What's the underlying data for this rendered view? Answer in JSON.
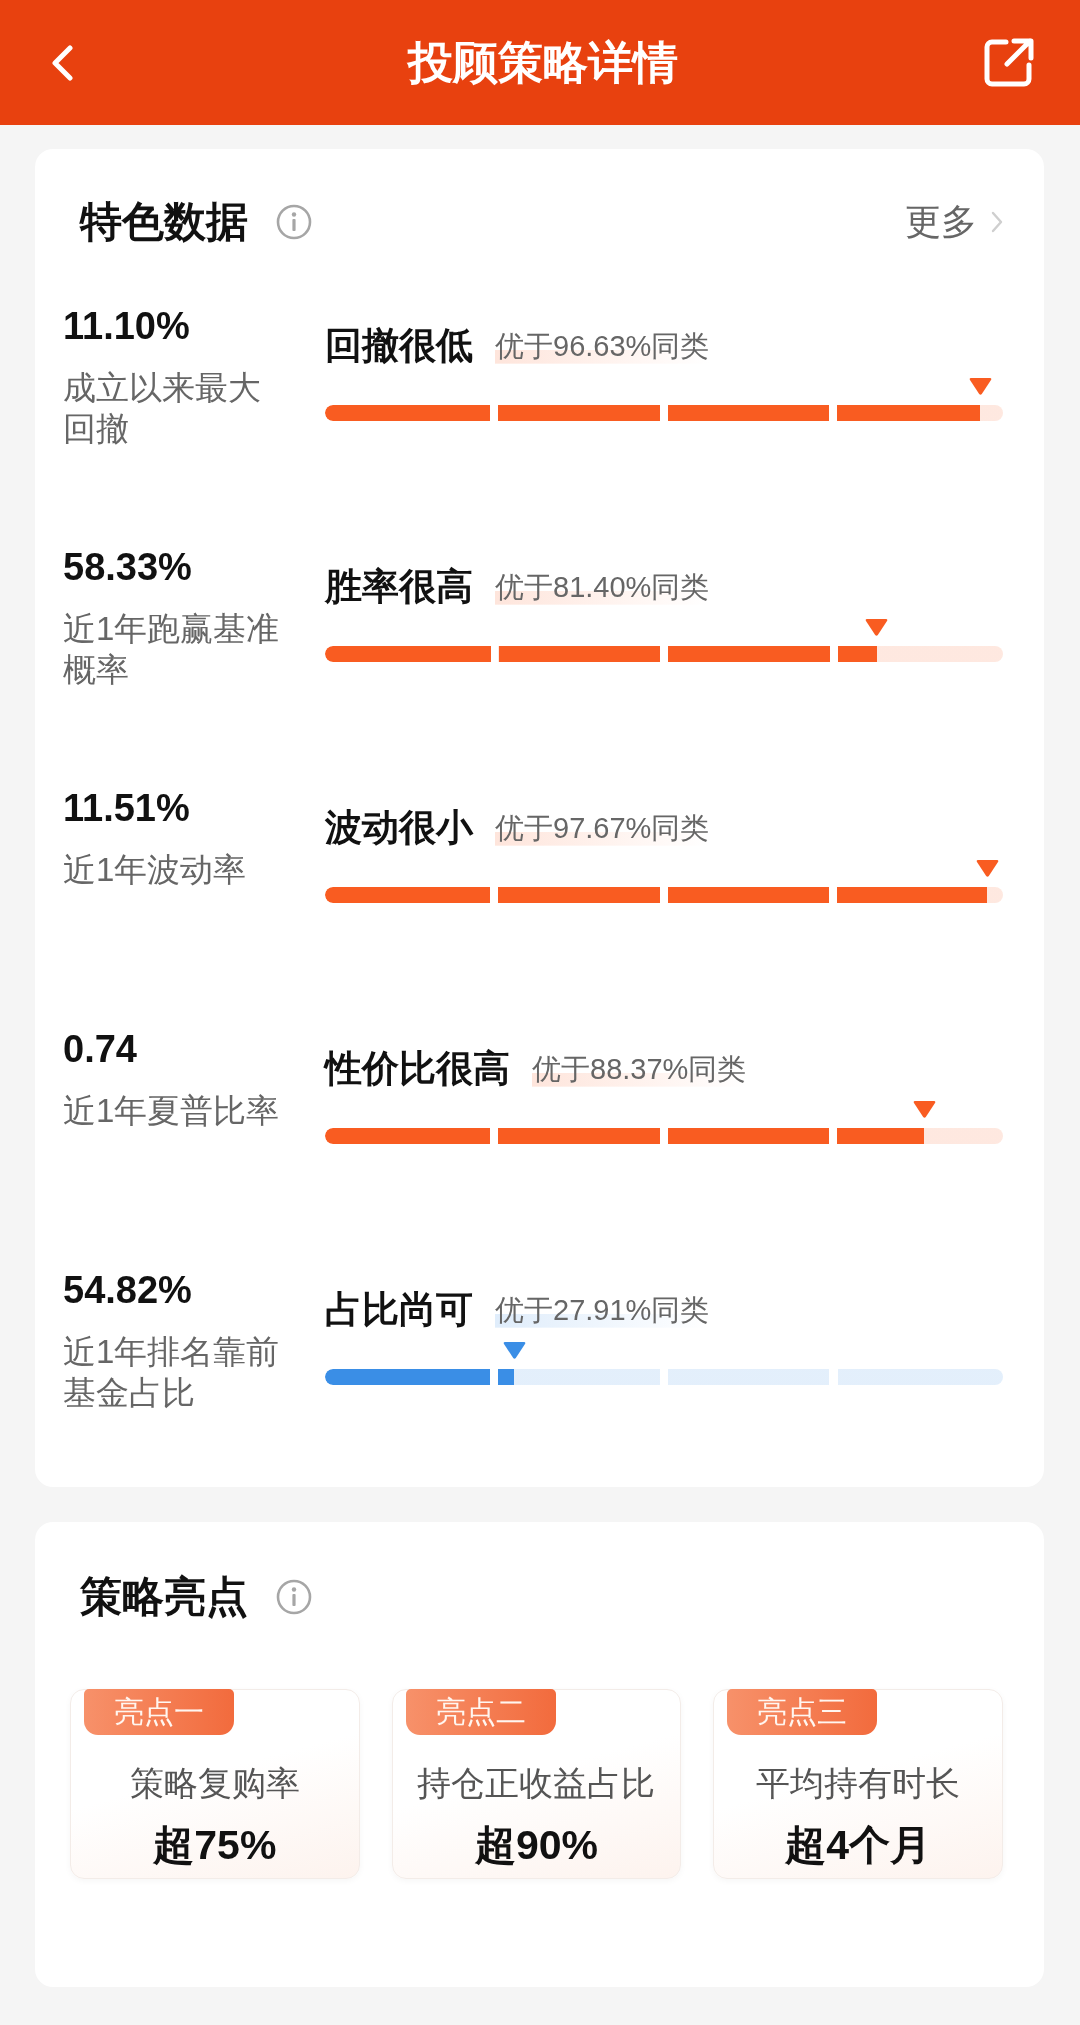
{
  "header": {
    "title": "投顾策略详情"
  },
  "features": {
    "title": "特色数据",
    "more": "更多",
    "metrics": [
      {
        "value": "11.10%",
        "label": "成立以来最大回撤",
        "tag": "回撤很低",
        "rank": "优于96.63%同类",
        "level": 0.9663,
        "color": "#f95c21"
      },
      {
        "value": "58.33%",
        "label": "近1年跑赢基准概率",
        "tag": "胜率很高",
        "rank": "优于81.40%同类",
        "level": 0.814,
        "color": "#f95c21"
      },
      {
        "value": "11.51%",
        "label": "近1年波动率",
        "tag": "波动很小",
        "rank": "优于97.67%同类",
        "level": 0.9767,
        "color": "#f95c21"
      },
      {
        "value": "0.74",
        "label": "近1年夏普比率",
        "tag": "性价比很高",
        "rank": "优于88.37%同类",
        "level": 0.8837,
        "color": "#f95c21"
      },
      {
        "value": "54.82%",
        "label": "近1年排名靠前基金占比",
        "tag": "占比尚可",
        "rank": "优于27.91%同类",
        "level": 0.2791,
        "color": "#3a8ee6"
      }
    ]
  },
  "highlights": {
    "title": "策略亮点",
    "items": [
      {
        "badge": "亮点一",
        "label": "策略复购率",
        "value": "超75%"
      },
      {
        "badge": "亮点二",
        "label": "持仓正收益占比",
        "value": "超90%"
      },
      {
        "badge": "亮点三",
        "label": "平均持有时长",
        "value": "超4个月"
      }
    ]
  }
}
